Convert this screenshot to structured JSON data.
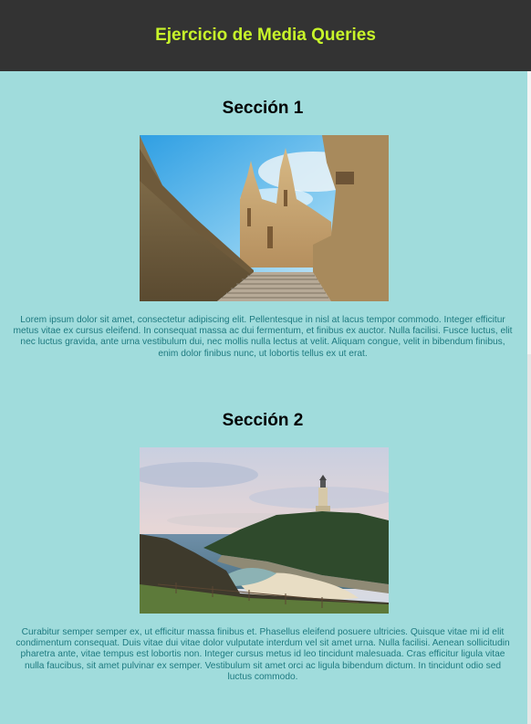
{
  "page": {
    "title": "Ejercicio de Media Queries",
    "colors": {
      "header_bg": "#333333",
      "title": "#c8f52a",
      "body_bg": "#a0dcdc",
      "text": "#1e7a80"
    }
  },
  "sections": [
    {
      "heading": "Sección 1",
      "image": "cathedral-photo",
      "text": "Lorem ipsum dolor sit amet, consectetur adipiscing elit. Pellentesque in nisl at lacus tempor commodo. Integer efficitur metus vitae ex cursus eleifend. In consequat massa ac dui fermentum, et finibus ex auctor. Nulla facilisi. Fusce luctus, elit nec luctus gravida, ante urna vestibulum dui, nec mollis nulla lectus at velit. Aliquam congue, velit in bibendum finibus, enim dolor finibus nunc, ut lobortis tellus ex ut erat."
    },
    {
      "heading": "Sección 2",
      "image": "lighthouse-photo",
      "text": "Curabitur semper semper ex, ut efficitur massa finibus et. Phasellus eleifend posuere ultricies. Quisque vitae mi id elit condimentum consequat. Duis vitae dui vitae dolor vulputate interdum vel sit amet urna. Nulla facilisi. Aenean sollicitudin pharetra ante, vitae tempus est lobortis non. Integer cursus metus id leo tincidunt malesuada. Cras efficitur ligula vitae nulla faucibus, sit amet pulvinar ex semper. Vestibulum sit amet orci ac ligula bibendum dictum. In tincidunt odio sed luctus commodo."
    }
  ]
}
